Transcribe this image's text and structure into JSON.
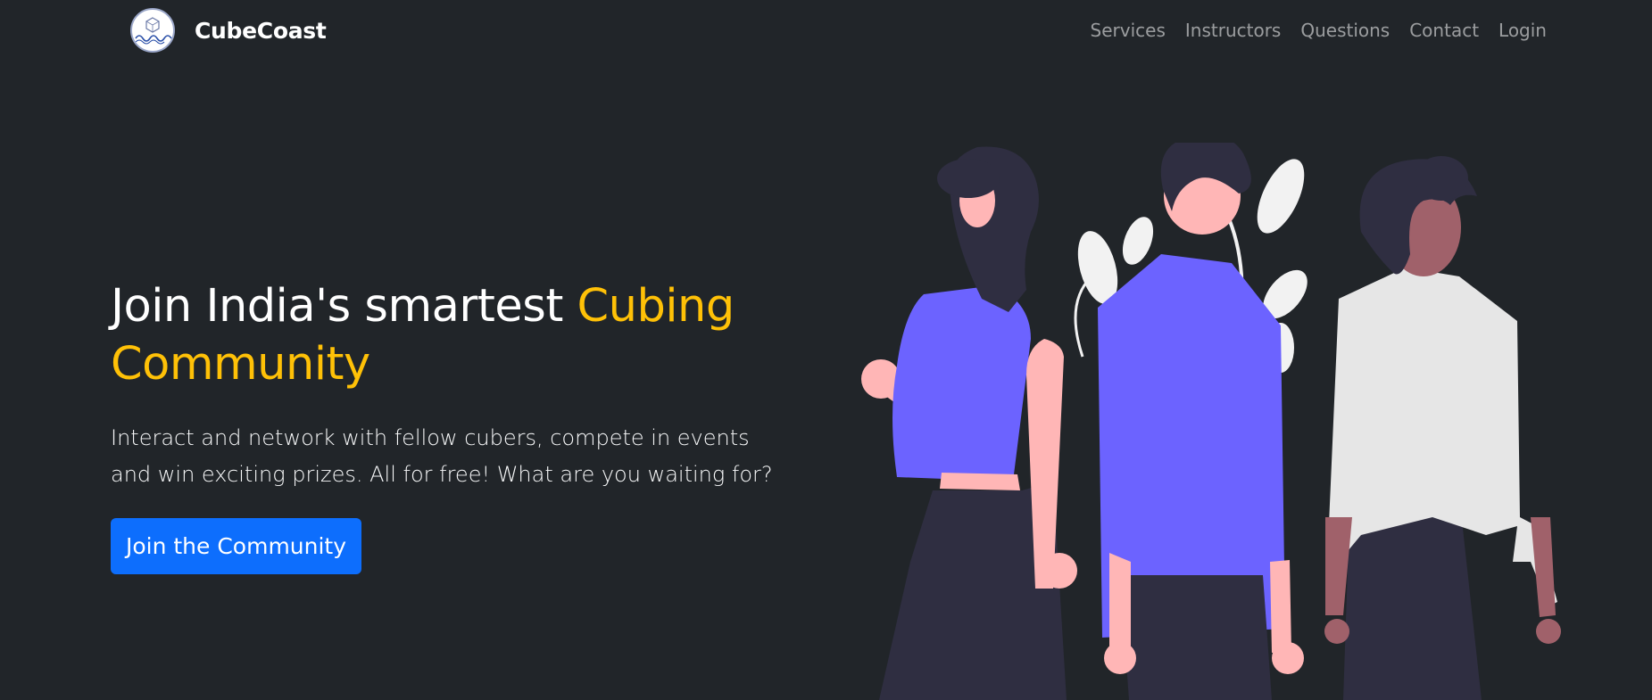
{
  "brand": {
    "name": "CubeCoast",
    "logo_icon": "cube-wave-logo-icon"
  },
  "nav": {
    "items": [
      {
        "label": "Services"
      },
      {
        "label": "Instructors"
      },
      {
        "label": "Questions"
      },
      {
        "label": "Contact"
      },
      {
        "label": "Login"
      }
    ]
  },
  "hero": {
    "title_part1": "Join India's smartest ",
    "title_accent": "Cubing Community",
    "subtitle": "Interact and network with fellow cubers, compete in events and win exciting prizes. All for free! What are you waiting for?",
    "cta_label": "Join the Community"
  },
  "colors": {
    "background": "#212529",
    "accent": "#ffc107",
    "primary": "#0d6efd",
    "illustration_purple": "#6c63ff",
    "illustration_dark": "#2f2e41",
    "skin_light": "#ffb6b6",
    "skin_dark": "#a0616a"
  },
  "illustration": {
    "icon": "people-group-illustration"
  }
}
